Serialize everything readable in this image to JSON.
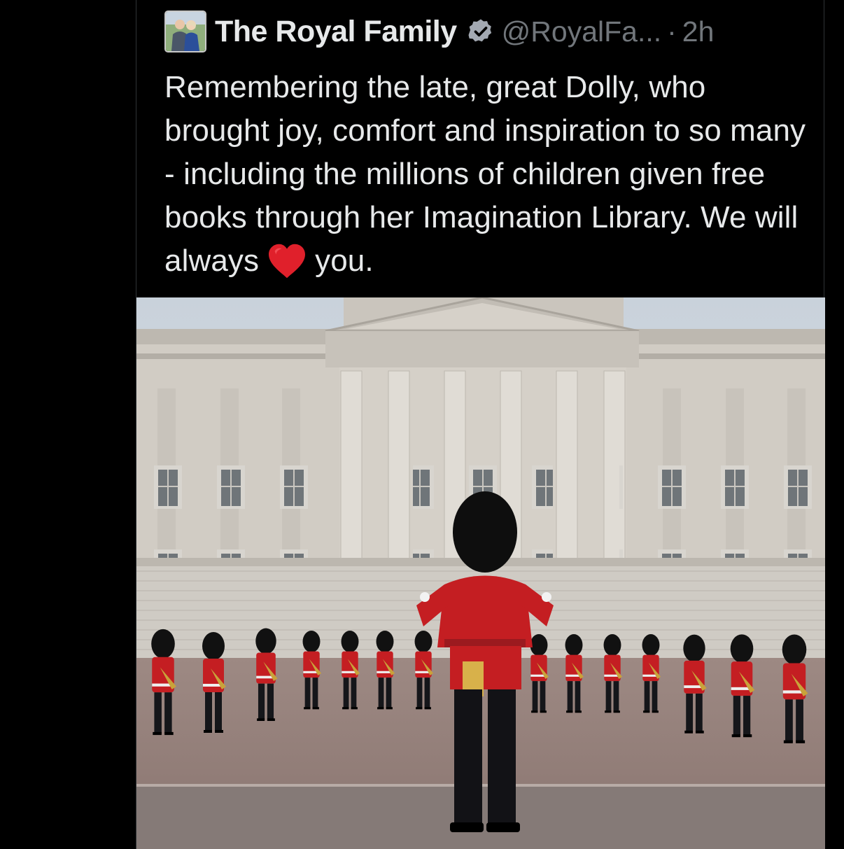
{
  "post": {
    "display_name": "The Royal Family",
    "handle": "@RoyalFa...",
    "separator": "·",
    "time": "2h",
    "text_before_emoji": "Remembering the late, great Dolly, who brought joy, comfort and inspiration to so many - including the millions of children given free books through her Imagination Library. We will always",
    "text_after_emoji": "you.",
    "emoji": "heart-emoji",
    "verified_badge_color": "#1d9bf0",
    "media_description_icon": "photo"
  },
  "colors": {
    "background": "#000000",
    "text": "#e7e9ea",
    "muted": "#71767b",
    "heart": "#e0202b"
  }
}
